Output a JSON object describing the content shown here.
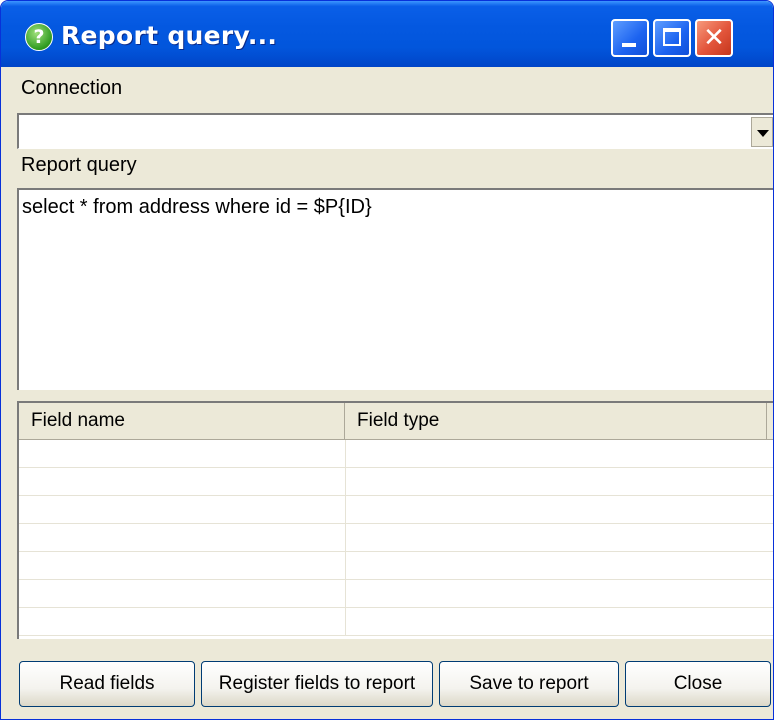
{
  "window": {
    "title": "Report query...",
    "help_icon_glyph": "?",
    "close_glyph": "✕"
  },
  "connection": {
    "label": "Connection",
    "selected_value": ""
  },
  "query": {
    "label": "Report query",
    "text": "select * from address where id = $P{ID}"
  },
  "fields_table": {
    "columns": [
      "Field name",
      "Field type"
    ],
    "rows": []
  },
  "buttons": {
    "read_fields": "Read fields",
    "register_fields": "Register fields to report",
    "save_to_report": "Save to report",
    "close": "Close"
  }
}
